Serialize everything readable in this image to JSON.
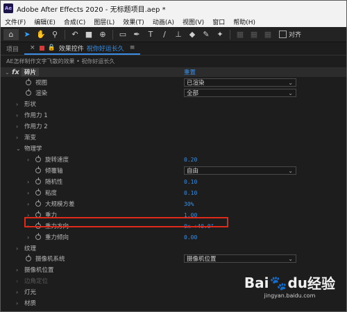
{
  "window": {
    "title": "Adobe After Effects 2020 - 无标题项目.aep *",
    "app_badge": "Ae"
  },
  "menu": [
    "文件(F)",
    "编辑(E)",
    "合成(C)",
    "图层(L)",
    "效果(T)",
    "动画(A)",
    "视图(V)",
    "窗口",
    "帮助(H)"
  ],
  "toolbar": {
    "icons": [
      "home-icon",
      "selection-arrow-icon",
      "hand-icon",
      "zoom-icon",
      "rotate-icon",
      "camera-icon",
      "pan-behind-icon",
      "rectangle-icon",
      "pen-icon",
      "text-icon",
      "brush-icon",
      "clone-stamp-icon",
      "eraser-icon",
      "roto-brush-icon",
      "puppet-pin-icon"
    ],
    "snap_label": "对齐"
  },
  "tabs": {
    "project": "项目",
    "effects_label": "效果控件",
    "effects_target": "祝你好运长久"
  },
  "breadcrumb": "AE怎样制作文字飞散的效果 • 祝你好运长久",
  "effect": {
    "fx": "fx",
    "name": "碎片",
    "reset": "重置",
    "rows": [
      {
        "label": "视图",
        "value": "已渲染",
        "kind": "dropdown"
      },
      {
        "label": "渲染",
        "value": "全部",
        "kind": "dropdown"
      },
      {
        "label": "形状",
        "kind": "group"
      },
      {
        "label": "作用力 1",
        "kind": "group"
      },
      {
        "label": "作用力 2",
        "kind": "group"
      },
      {
        "label": "渐变",
        "kind": "group"
      },
      {
        "label": "物理学",
        "kind": "group-open"
      },
      {
        "label": "旋转速度",
        "value": "0.20",
        "kind": "value"
      },
      {
        "label": "倾覆轴",
        "value": "自由",
        "kind": "dropdown"
      },
      {
        "label": "随机性",
        "value": "0.10",
        "kind": "value"
      },
      {
        "label": "粘度",
        "value": "0.10",
        "kind": "value"
      },
      {
        "label": "大规模方差",
        "value": "30%",
        "kind": "value"
      },
      {
        "label": "重力",
        "value": "1.00",
        "kind": "value"
      },
      {
        "label": "重力方向",
        "value": "0x +40.0°",
        "kind": "value"
      },
      {
        "label": "重力倾向",
        "value": "0.00",
        "kind": "value"
      },
      {
        "label": "纹理",
        "kind": "group"
      },
      {
        "label": "摄像机系统",
        "value": "摄像机位置",
        "kind": "dropdown"
      },
      {
        "label": "摄像机位置",
        "kind": "group"
      },
      {
        "label": "边角定位",
        "kind": "group-disabled"
      },
      {
        "label": "灯光",
        "kind": "group"
      },
      {
        "label": "材质",
        "kind": "group"
      }
    ]
  },
  "watermark": {
    "brand_left": "Bai",
    "brand_mid": "du",
    "brand_right": "经验",
    "url": "jingyan.baidu.com"
  }
}
